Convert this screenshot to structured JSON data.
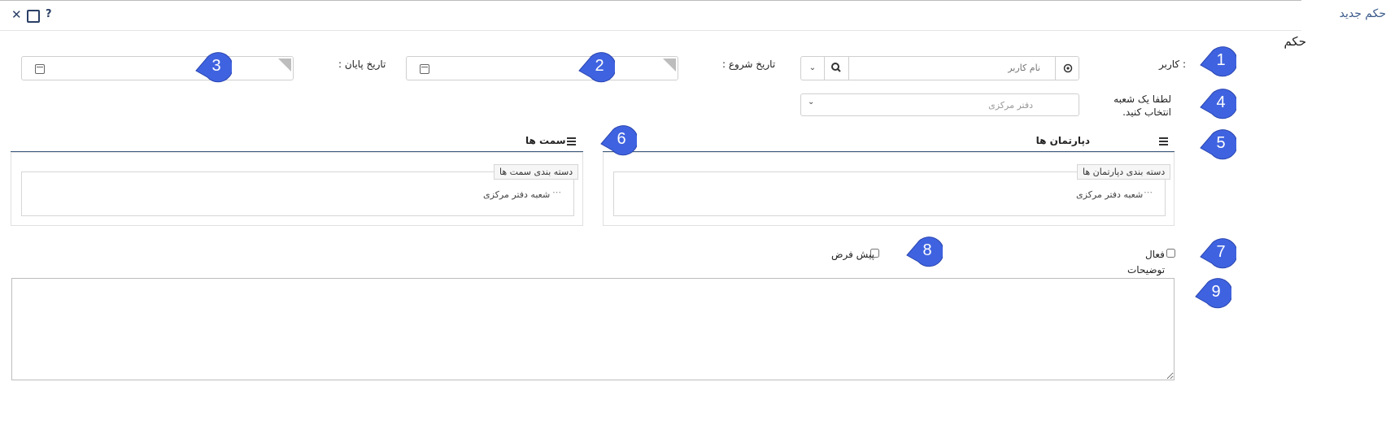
{
  "window": {
    "title": "حکم جدید",
    "close_icon": "✕",
    "help_icon": "?"
  },
  "form": {
    "title": "حکم",
    "user": {
      "label": "کاربر :",
      "placeholder": "نام کاربر"
    },
    "start_date": {
      "label": "تاریخ شروع :"
    },
    "end_date": {
      "label": "تاریخ پایان :"
    },
    "branch": {
      "label": "لطفا یک شعبه انتخاب کنید.",
      "selected": "دفتر مرکزی"
    },
    "departments": {
      "title": "دپارتمان ها",
      "category_label": "دسته بندی دپارتمان ها",
      "item": "شعبه دفتر مرکزی",
      "item_dots": "⋯"
    },
    "positions": {
      "title": "سمت ها",
      "category_label": "دسته بندی سمت ها",
      "item": "شعبه دفتر مرکزی",
      "item_dots": "⋯"
    },
    "active_label": "فعال",
    "default_label": "پیش فرض",
    "description_label": "توضیحات"
  },
  "annotations": [
    "1",
    "2",
    "3",
    "4",
    "5",
    "6",
    "7",
    "8",
    "9"
  ],
  "colors": {
    "bubble": "#3f63e0",
    "title_blue": "#3b5a8a",
    "panel_line": "#3d5a80"
  }
}
